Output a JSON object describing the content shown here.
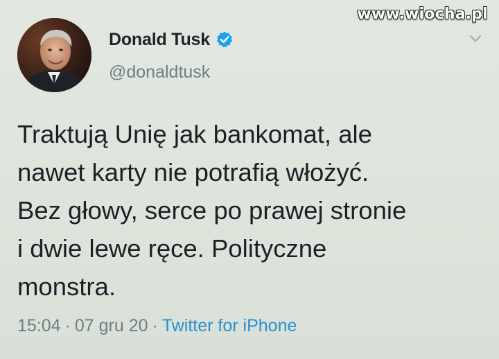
{
  "watermark": "www.wiocha.pl",
  "author": {
    "name": "Donald Tusk",
    "handle": "@donaldtusk",
    "verified": true
  },
  "tweet": {
    "lines": [
      "Traktują Unię jak bankomat, ale",
      "nawet karty nie potrafią włożyć.",
      "Bez głowy, serce po prawej stronie",
      "i dwie lewe ręce. Polityczne",
      "monstra."
    ],
    "time": "15:04",
    "separator": "·",
    "date": "07 gru 20",
    "source": "Twitter for iPhone"
  },
  "colors": {
    "background": "#dfe6dd",
    "text": "#1a2126",
    "muted": "#6f7d87",
    "link": "#2a8fcf",
    "verified_badge": "#1da1f2"
  },
  "icons": {
    "verified": "verified-badge-icon",
    "menu": "chevron-down-icon"
  }
}
